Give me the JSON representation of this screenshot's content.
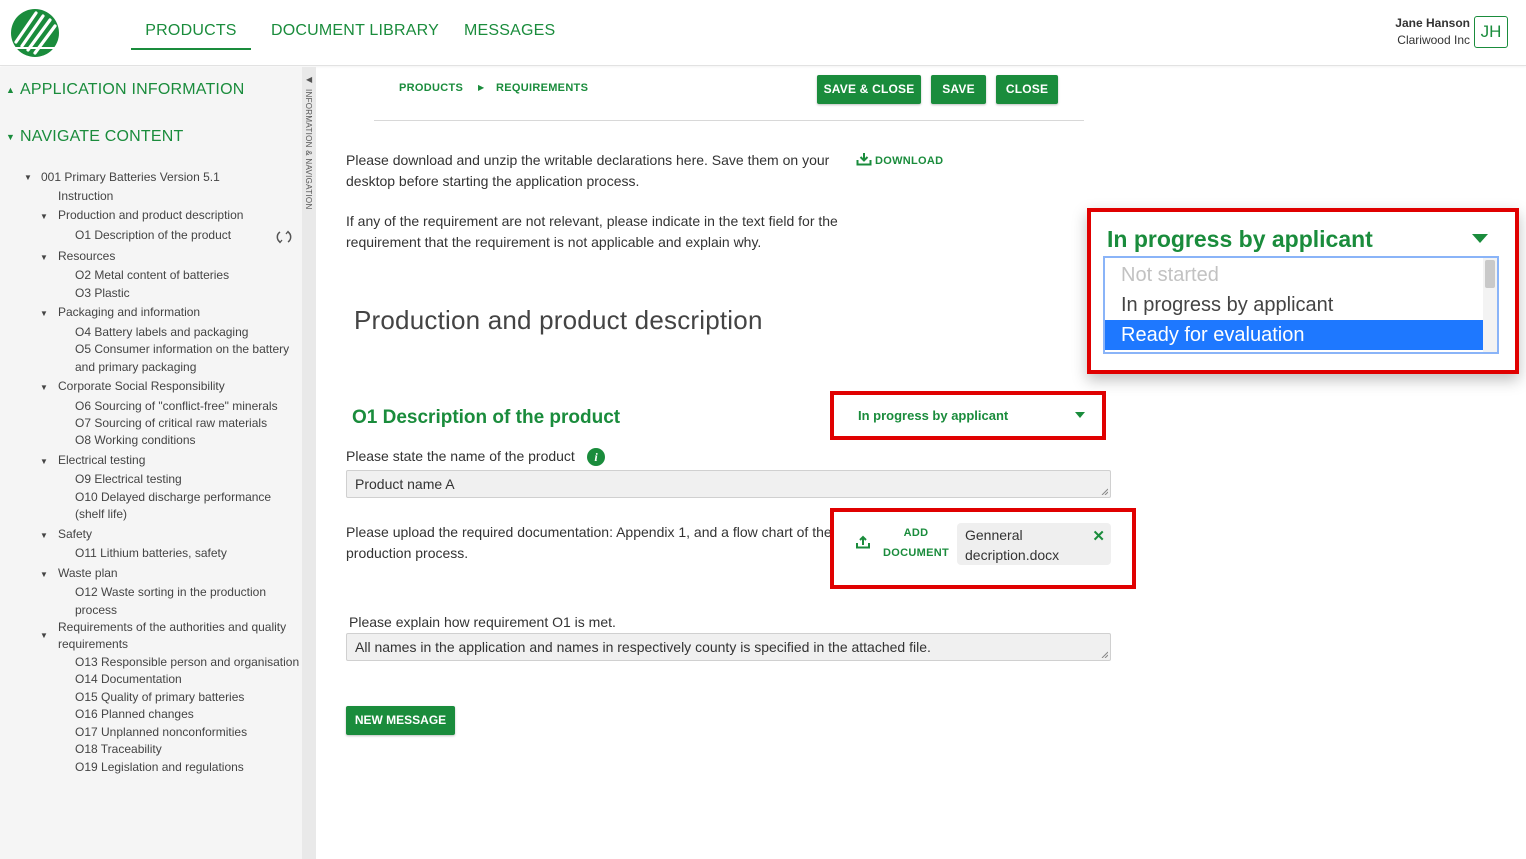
{
  "header": {
    "tabs": [
      "PRODUCTS",
      "DOCUMENT LIBRARY",
      "MESSAGES"
    ],
    "active_tab": "PRODUCTS",
    "user": {
      "name": "Jane Hanson",
      "company": "Clariwood Inc",
      "initials": "JH"
    }
  },
  "sidebar": {
    "section_application": "APPLICATION INFORMATION",
    "section_navigate": "NAVIGATE CONTENT",
    "strip_label": "INFORMATION & NAVIGATION",
    "tree": [
      "001 Primary Batteries Version 5.1",
      "Instruction",
      "Production and product description",
      "O1 Description of the product",
      "Resources",
      "O2 Metal content of batteries",
      "O3 Plastic",
      "Packaging and information",
      "O4 Battery labels and packaging",
      "O5 Consumer information on the battery",
      "and primary packaging",
      "Corporate Social Responsibility",
      "O6 Sourcing of \"conflict-free\" minerals",
      "O7 Sourcing of critical raw materials",
      "O8 Working conditions",
      "Electrical testing",
      "O9 Electrical testing",
      "O10 Delayed discharge performance",
      "(shelf life)",
      "Safety",
      "O11 Lithium batteries, safety",
      "Waste plan",
      "O12 Waste sorting in the production",
      "process",
      "Requirements of the authorities and quality",
      "requirements",
      "O13 Responsible person and organisation",
      "O14 Documentation",
      "O15 Quality of primary batteries",
      "O16 Planned changes",
      "O17 Unplanned nonconformities",
      "O18 Traceability",
      "O19 Legislation and regulations"
    ]
  },
  "breadcrumb": {
    "first": "PRODUCTS",
    "second": "REQUIREMENTS"
  },
  "toolbar": {
    "save_close": "SAVE & CLOSE",
    "save": "SAVE",
    "close": "CLOSE"
  },
  "intro": {
    "download_line1": "Please download and unzip the writable declarations here. Save them on your",
    "download_line2": "desktop before starting the application process.",
    "download_label": "DOWNLOAD",
    "relevance_line1": "If any of the requirement are not relevant, please indicate in the text field for the",
    "relevance_line2": "requirement that the requirement is not applicable and explain why."
  },
  "section": {
    "title": "Production and product description"
  },
  "requirement": {
    "title": "O1 Description of the product",
    "status": "In progress by applicant",
    "name_label": "Please state the name of the product",
    "name_value": "Product name A",
    "upload_line1": "Please upload the required documentation: Appendix 1, and a flow chart of the",
    "upload_line2": "production process.",
    "add_doc_line1": "ADD",
    "add_doc_line2": "DOCUMENT",
    "file_line1": "Genneral",
    "file_line2": "decription.docx",
    "explain_label": "Please explain how requirement O1 is met.",
    "explain_value": "All names in the application and names in respectively county is specified in the attached file.",
    "new_message": "NEW MESSAGE"
  },
  "status_dropdown": {
    "current": "In progress by applicant",
    "options": [
      "Not started",
      "In progress by applicant",
      "Ready for evaluation"
    ],
    "highlighted": "Ready for evaluation"
  },
  "colors": {
    "accent": "#1a8c3c",
    "highlight_box": "#e00000",
    "selected_option": "#1e78ff"
  }
}
